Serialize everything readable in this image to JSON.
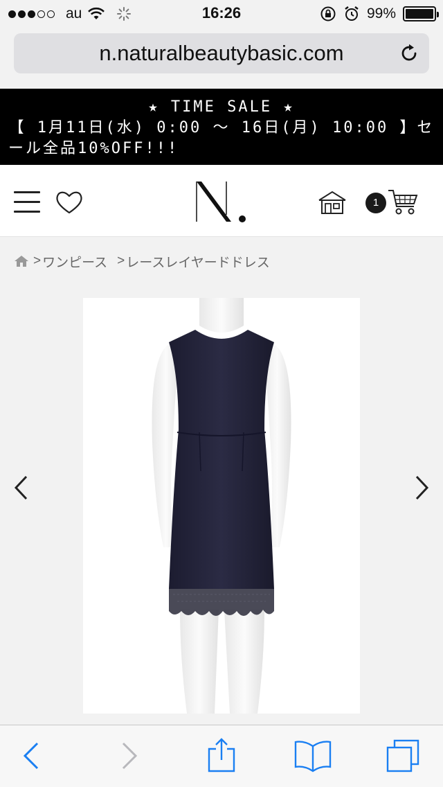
{
  "status_bar": {
    "carrier": "au",
    "time": "16:26",
    "battery_percent": "99%",
    "battery_level": 0.99,
    "signal_bars_filled": 3,
    "signal_bars_total": 5
  },
  "browser": {
    "url": "n.naturalbeautybasic.com"
  },
  "banner": {
    "line1": "★ TIME SALE ★",
    "line2": "【 1月11日(水) 0:00 〜 16日(月) 10:00 】セ",
    "line3": "ール全品10%OFF!!!"
  },
  "header": {
    "cart_count": "1"
  },
  "breadcrumb": {
    "separator": ">",
    "items": [
      "ワンピース",
      "レースレイヤードドレス"
    ]
  },
  "colors": {
    "banner_bg": "#000000",
    "ios_blue": "#1a7ff2",
    "dress_navy": "#22223a"
  },
  "icons": {
    "menu": "hamburger-icon",
    "favorite": "heart-icon",
    "home": "home-icon",
    "cart": "cart-icon",
    "reload": "reload-icon",
    "share": "share-icon",
    "bookmarks": "book-icon",
    "tabs": "tabs-icon"
  }
}
